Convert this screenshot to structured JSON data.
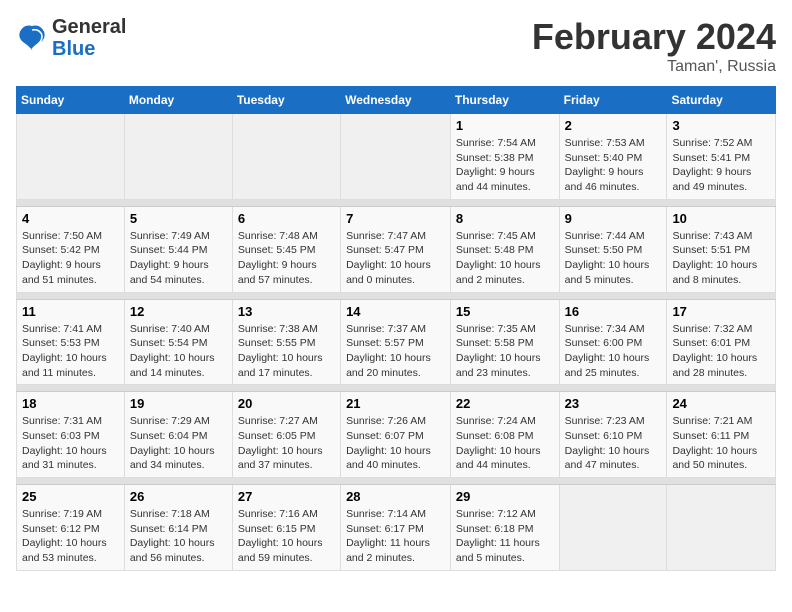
{
  "header": {
    "logo_general": "General",
    "logo_blue": "Blue",
    "month_year": "February 2024",
    "location": "Taman', Russia"
  },
  "days_of_week": [
    "Sunday",
    "Monday",
    "Tuesday",
    "Wednesday",
    "Thursday",
    "Friday",
    "Saturday"
  ],
  "weeks": [
    [
      {
        "day": "",
        "sunrise": "",
        "sunset": "",
        "daylight": ""
      },
      {
        "day": "",
        "sunrise": "",
        "sunset": "",
        "daylight": ""
      },
      {
        "day": "",
        "sunrise": "",
        "sunset": "",
        "daylight": ""
      },
      {
        "day": "",
        "sunrise": "",
        "sunset": "",
        "daylight": ""
      },
      {
        "day": "1",
        "sunrise": "Sunrise: 7:54 AM",
        "sunset": "Sunset: 5:38 PM",
        "daylight": "Daylight: 9 hours and 44 minutes."
      },
      {
        "day": "2",
        "sunrise": "Sunrise: 7:53 AM",
        "sunset": "Sunset: 5:40 PM",
        "daylight": "Daylight: 9 hours and 46 minutes."
      },
      {
        "day": "3",
        "sunrise": "Sunrise: 7:52 AM",
        "sunset": "Sunset: 5:41 PM",
        "daylight": "Daylight: 9 hours and 49 minutes."
      }
    ],
    [
      {
        "day": "4",
        "sunrise": "Sunrise: 7:50 AM",
        "sunset": "Sunset: 5:42 PM",
        "daylight": "Daylight: 9 hours and 51 minutes."
      },
      {
        "day": "5",
        "sunrise": "Sunrise: 7:49 AM",
        "sunset": "Sunset: 5:44 PM",
        "daylight": "Daylight: 9 hours and 54 minutes."
      },
      {
        "day": "6",
        "sunrise": "Sunrise: 7:48 AM",
        "sunset": "Sunset: 5:45 PM",
        "daylight": "Daylight: 9 hours and 57 minutes."
      },
      {
        "day": "7",
        "sunrise": "Sunrise: 7:47 AM",
        "sunset": "Sunset: 5:47 PM",
        "daylight": "Daylight: 10 hours and 0 minutes."
      },
      {
        "day": "8",
        "sunrise": "Sunrise: 7:45 AM",
        "sunset": "Sunset: 5:48 PM",
        "daylight": "Daylight: 10 hours and 2 minutes."
      },
      {
        "day": "9",
        "sunrise": "Sunrise: 7:44 AM",
        "sunset": "Sunset: 5:50 PM",
        "daylight": "Daylight: 10 hours and 5 minutes."
      },
      {
        "day": "10",
        "sunrise": "Sunrise: 7:43 AM",
        "sunset": "Sunset: 5:51 PM",
        "daylight": "Daylight: 10 hours and 8 minutes."
      }
    ],
    [
      {
        "day": "11",
        "sunrise": "Sunrise: 7:41 AM",
        "sunset": "Sunset: 5:53 PM",
        "daylight": "Daylight: 10 hours and 11 minutes."
      },
      {
        "day": "12",
        "sunrise": "Sunrise: 7:40 AM",
        "sunset": "Sunset: 5:54 PM",
        "daylight": "Daylight: 10 hours and 14 minutes."
      },
      {
        "day": "13",
        "sunrise": "Sunrise: 7:38 AM",
        "sunset": "Sunset: 5:55 PM",
        "daylight": "Daylight: 10 hours and 17 minutes."
      },
      {
        "day": "14",
        "sunrise": "Sunrise: 7:37 AM",
        "sunset": "Sunset: 5:57 PM",
        "daylight": "Daylight: 10 hours and 20 minutes."
      },
      {
        "day": "15",
        "sunrise": "Sunrise: 7:35 AM",
        "sunset": "Sunset: 5:58 PM",
        "daylight": "Daylight: 10 hours and 23 minutes."
      },
      {
        "day": "16",
        "sunrise": "Sunrise: 7:34 AM",
        "sunset": "Sunset: 6:00 PM",
        "daylight": "Daylight: 10 hours and 25 minutes."
      },
      {
        "day": "17",
        "sunrise": "Sunrise: 7:32 AM",
        "sunset": "Sunset: 6:01 PM",
        "daylight": "Daylight: 10 hours and 28 minutes."
      }
    ],
    [
      {
        "day": "18",
        "sunrise": "Sunrise: 7:31 AM",
        "sunset": "Sunset: 6:03 PM",
        "daylight": "Daylight: 10 hours and 31 minutes."
      },
      {
        "day": "19",
        "sunrise": "Sunrise: 7:29 AM",
        "sunset": "Sunset: 6:04 PM",
        "daylight": "Daylight: 10 hours and 34 minutes."
      },
      {
        "day": "20",
        "sunrise": "Sunrise: 7:27 AM",
        "sunset": "Sunset: 6:05 PM",
        "daylight": "Daylight: 10 hours and 37 minutes."
      },
      {
        "day": "21",
        "sunrise": "Sunrise: 7:26 AM",
        "sunset": "Sunset: 6:07 PM",
        "daylight": "Daylight: 10 hours and 40 minutes."
      },
      {
        "day": "22",
        "sunrise": "Sunrise: 7:24 AM",
        "sunset": "Sunset: 6:08 PM",
        "daylight": "Daylight: 10 hours and 44 minutes."
      },
      {
        "day": "23",
        "sunrise": "Sunrise: 7:23 AM",
        "sunset": "Sunset: 6:10 PM",
        "daylight": "Daylight: 10 hours and 47 minutes."
      },
      {
        "day": "24",
        "sunrise": "Sunrise: 7:21 AM",
        "sunset": "Sunset: 6:11 PM",
        "daylight": "Daylight: 10 hours and 50 minutes."
      }
    ],
    [
      {
        "day": "25",
        "sunrise": "Sunrise: 7:19 AM",
        "sunset": "Sunset: 6:12 PM",
        "daylight": "Daylight: 10 hours and 53 minutes."
      },
      {
        "day": "26",
        "sunrise": "Sunrise: 7:18 AM",
        "sunset": "Sunset: 6:14 PM",
        "daylight": "Daylight: 10 hours and 56 minutes."
      },
      {
        "day": "27",
        "sunrise": "Sunrise: 7:16 AM",
        "sunset": "Sunset: 6:15 PM",
        "daylight": "Daylight: 10 hours and 59 minutes."
      },
      {
        "day": "28",
        "sunrise": "Sunrise: 7:14 AM",
        "sunset": "Sunset: 6:17 PM",
        "daylight": "Daylight: 11 hours and 2 minutes."
      },
      {
        "day": "29",
        "sunrise": "Sunrise: 7:12 AM",
        "sunset": "Sunset: 6:18 PM",
        "daylight": "Daylight: 11 hours and 5 minutes."
      },
      {
        "day": "",
        "sunrise": "",
        "sunset": "",
        "daylight": ""
      },
      {
        "day": "",
        "sunrise": "",
        "sunset": "",
        "daylight": ""
      }
    ]
  ]
}
